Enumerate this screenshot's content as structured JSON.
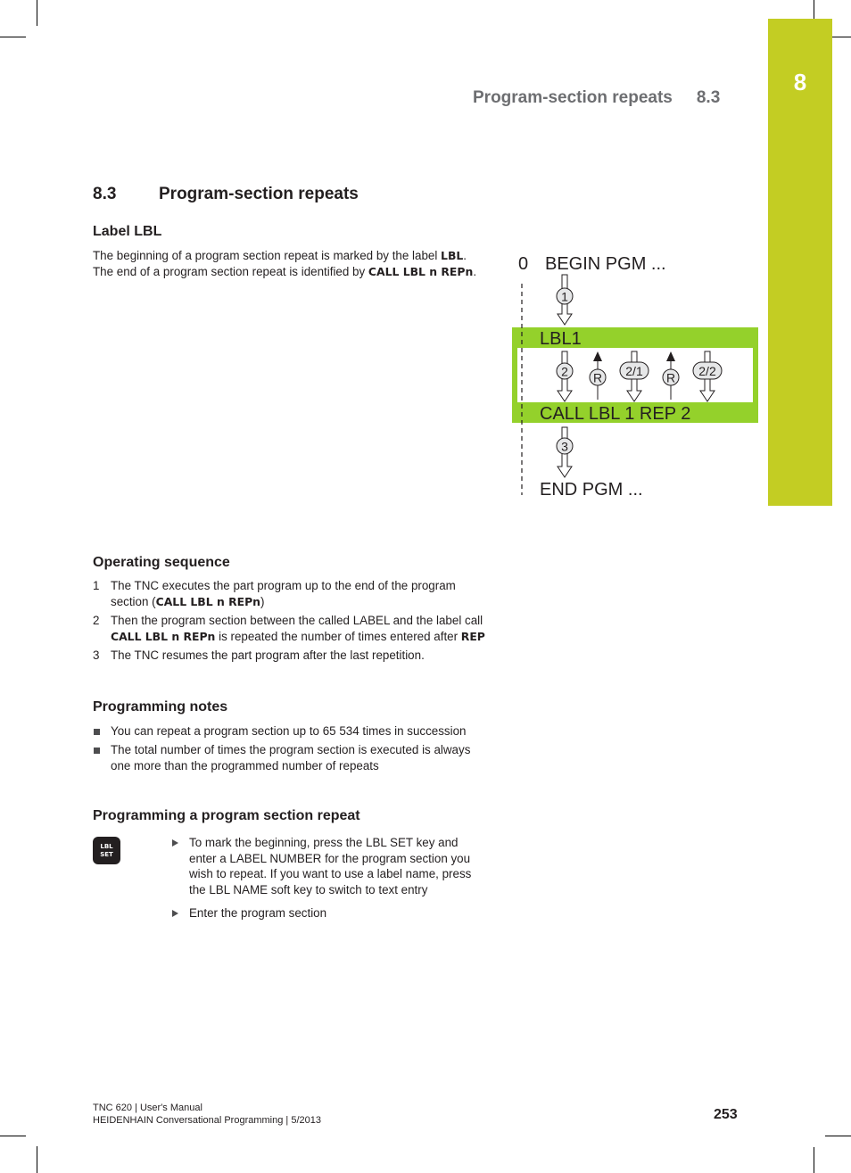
{
  "header": {
    "running_title": "Program-section repeats",
    "running_number": "8.3",
    "chapter_tab_number": "8"
  },
  "colors": {
    "chapter_tab": "#c3cd23",
    "diagram_green": "#94d12b",
    "running_head_gray": "#6d6e71",
    "text": "#231f20"
  },
  "section": {
    "number": "8.3",
    "title": "Program-section repeats"
  },
  "label_lbl": {
    "heading": "Label LBL",
    "text_1": "The beginning of a program section repeat is marked by the label ",
    "bold_1": "LBL",
    "text_2": ". The end of a program section repeat is identified by ",
    "bold_2": "CALL LBL n REPn",
    "text_3": "."
  },
  "diagram": {
    "begin_num": "0",
    "begin_label": "BEGIN PGM ...",
    "lbl_label": "LBL1",
    "call_label": "CALL LBL 1 REP 2",
    "end_label": "END PGM ...",
    "step_1": "1",
    "step_2": "2",
    "repeat_1": "R",
    "step_2_1": "2/1",
    "repeat_2": "R",
    "step_2_2": "2/2",
    "step_3": "3"
  },
  "operating_sequence": {
    "heading": "Operating sequence",
    "items": [
      {
        "marker": "1",
        "text_1": "The TNC executes the part program up to the end of the program section (",
        "bold_1": "CALL LBL n REPn",
        "text_2": ")"
      },
      {
        "marker": "2",
        "text_1": "Then the program section between the called LABEL and the label call ",
        "bold_1": "CALL LBL n REPn",
        "text_2": " is repeated the number of times entered after ",
        "bold_2": "REP"
      },
      {
        "marker": "3",
        "text_1": "The TNC resumes the part program after the last repetition."
      }
    ]
  },
  "programming_notes": {
    "heading": "Programming notes",
    "items": [
      "You can repeat a program section up to 65 534 times in succession",
      "The total number of times the program section is executed is always one more than the programmed number of repeats"
    ]
  },
  "programming_repeat": {
    "heading": "Programming a program section repeat",
    "key_line_1": "LBL",
    "key_line_2": "SET",
    "steps": [
      "To mark the beginning, press the LBL SET key and enter a LABEL NUMBER for the program section you wish to repeat. If you want to use a label name, press the LBL NAME soft key to switch to text entry",
      "Enter the program section"
    ]
  },
  "footer": {
    "line_1": "TNC 620 | User's Manual",
    "line_2": "HEIDENHAIN Conversational Programming | 5/2013",
    "page_number": "253"
  }
}
